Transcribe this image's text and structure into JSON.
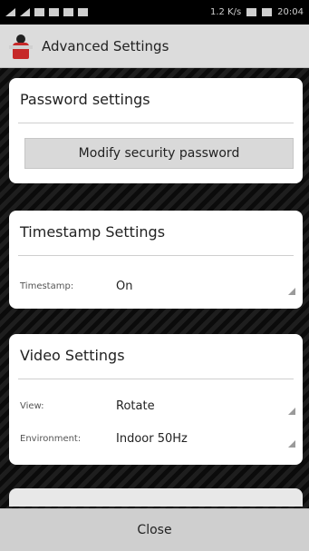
{
  "statusbar": {
    "speed": "1.2 K/s",
    "time": "20:04"
  },
  "appbar": {
    "title": "Advanced Settings"
  },
  "password_card": {
    "title": "Password settings",
    "button_label": "Modify security password"
  },
  "timestamp_card": {
    "title": "Timestamp Settings",
    "rows": [
      {
        "label": "Timestamp:",
        "value": "On"
      }
    ]
  },
  "video_card": {
    "title": "Video Settings",
    "rows": [
      {
        "label": "View:",
        "value": "Rotate"
      },
      {
        "label": "Environment:",
        "value": "Indoor 50Hz"
      }
    ]
  },
  "footer": {
    "close_label": "Close"
  }
}
